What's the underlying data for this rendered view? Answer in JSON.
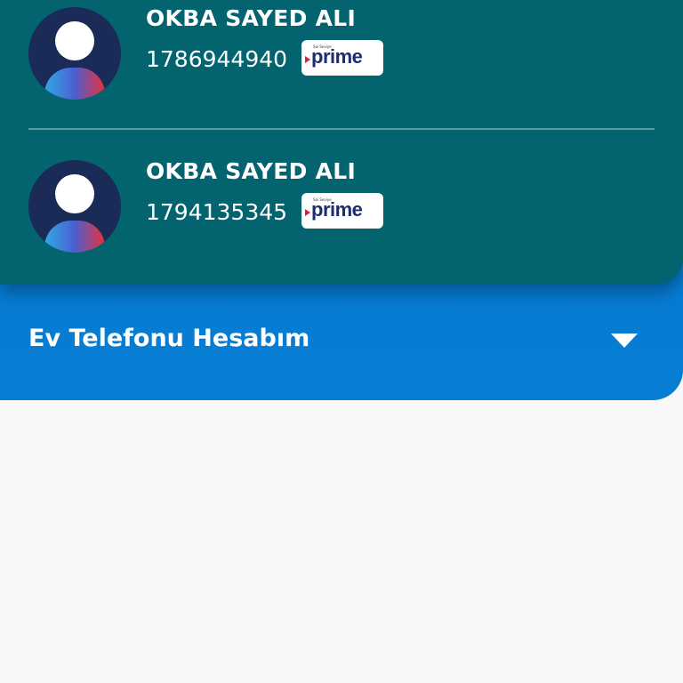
{
  "accounts": [
    {
      "name": "OKBA SAYED ALI",
      "number": "1786944940",
      "badge": "prime",
      "badge_small": "Sai Seviye"
    },
    {
      "name": "OKBA SAYED ALI",
      "number": "1794135345",
      "badge": "prime",
      "badge_small": "Sai Seviye"
    }
  ],
  "home_phone": {
    "title": "Ev Telefonu Hesabım",
    "toggle_icon": "chevron-down-icon"
  },
  "colors": {
    "teal_card": "#03636f",
    "blue_section": "#077ed4",
    "avatar_bg": "#1a2b57",
    "background": "#f6f8fa",
    "brand_navy": "#1d2e6e",
    "brand_red": "#d8213a"
  }
}
